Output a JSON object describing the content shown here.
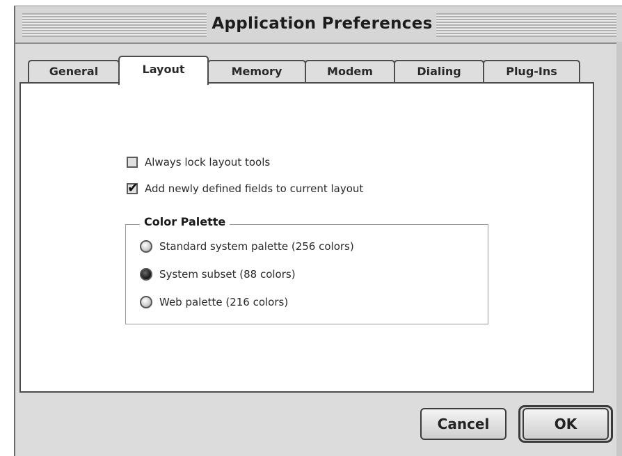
{
  "window": {
    "title": "Application Preferences"
  },
  "tabs": [
    {
      "label": "General",
      "active": false
    },
    {
      "label": "Layout",
      "active": true
    },
    {
      "label": "Memory",
      "active": false
    },
    {
      "label": "Modem",
      "active": false
    },
    {
      "label": "Dialing",
      "active": false
    },
    {
      "label": "Plug-Ins",
      "active": false
    }
  ],
  "layout": {
    "always_lock": {
      "label": "Always lock layout tools",
      "checked": false
    },
    "add_fields": {
      "label": "Add newly defined fields to current layout",
      "checked": true
    }
  },
  "color_palette": {
    "label": "Color Palette",
    "options": [
      {
        "label": "Standard system palette (256 colors)",
        "selected": false
      },
      {
        "label": "System subset (88 colors)",
        "selected": true
      },
      {
        "label": "Web palette (216 colors)",
        "selected": false
      }
    ]
  },
  "buttons": {
    "cancel": "Cancel",
    "ok": "OK"
  }
}
